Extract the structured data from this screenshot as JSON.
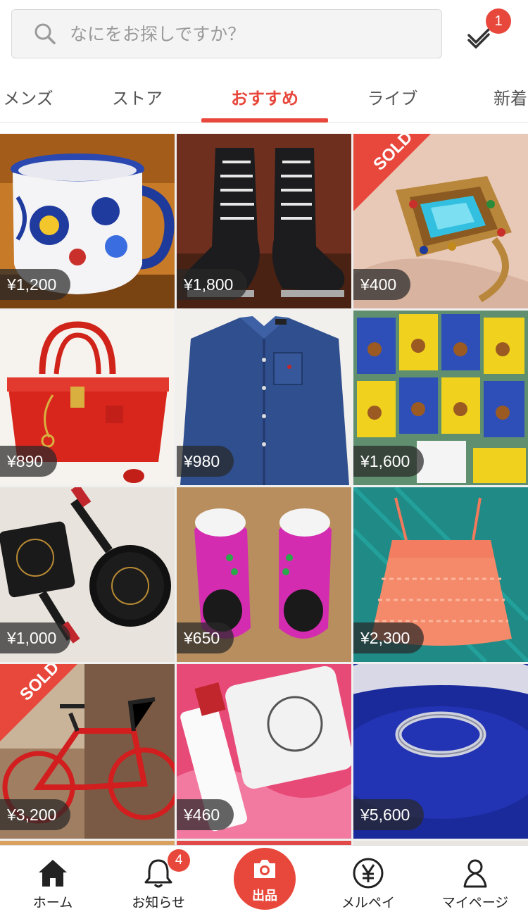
{
  "search": {
    "placeholder": "なにをお探しですか？"
  },
  "todo": {
    "badge": "1",
    "icon": "checklist-icon"
  },
  "tabs": [
    {
      "label": "メンズ",
      "active": false
    },
    {
      "label": "ストア",
      "active": false
    },
    {
      "label": "おすすめ",
      "active": true
    },
    {
      "label": "ライブ",
      "active": false
    },
    {
      "label": "新着",
      "active": false
    }
  ],
  "items": [
    {
      "price": "¥1,200",
      "sold": false,
      "subject": "mug"
    },
    {
      "price": "¥1,800",
      "sold": false,
      "subject": "boots"
    },
    {
      "price": "¥400",
      "sold": true,
      "subject": "ring"
    },
    {
      "price": "¥890",
      "sold": false,
      "subject": "red-handbag"
    },
    {
      "price": "¥980",
      "sold": false,
      "subject": "denim-shirt"
    },
    {
      "price": "¥1,600",
      "sold": false,
      "subject": "book-cards"
    },
    {
      "price": "¥1,000",
      "sold": false,
      "subject": "frying-pans"
    },
    {
      "price": "¥650",
      "sold": false,
      "subject": "pink-shoes"
    },
    {
      "price": "¥2,300",
      "sold": false,
      "subject": "lace-top"
    },
    {
      "price": "¥3,200",
      "sold": true,
      "subject": "red-bicycle"
    },
    {
      "price": "¥460",
      "sold": false,
      "subject": "cosmetics"
    },
    {
      "price": "¥5,600",
      "sold": false,
      "subject": "silver-ring"
    }
  ],
  "sold_label": "SOLD",
  "bottom_nav": {
    "home": "ホーム",
    "notifications": "お知らせ",
    "notifications_badge": "4",
    "sell": "出品",
    "merpay": "メルペイ",
    "mypage": "マイページ"
  },
  "colors": {
    "accent": "#e8483c"
  }
}
